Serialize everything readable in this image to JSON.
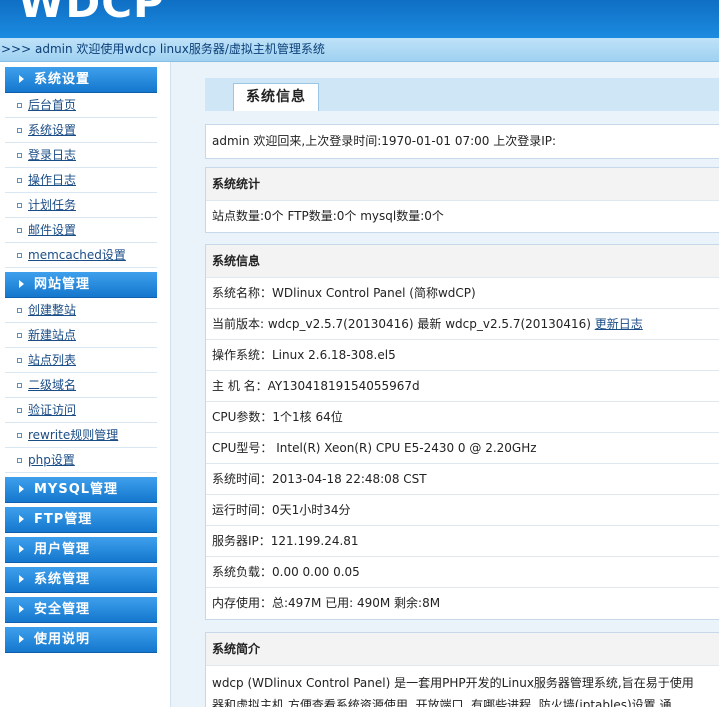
{
  "header": {
    "logo": "WDCP",
    "breadcrumb": ">>> admin 欢迎使用wdcp linux服务器/虚拟主机管理系统"
  },
  "sidebar": {
    "sections": [
      {
        "title": "系统设置",
        "items": [
          "后台首页",
          "系统设置",
          "登录日志",
          "操作日志",
          "计划任务",
          "邮件设置",
          "memcached设置"
        ]
      },
      {
        "title": "网站管理",
        "items": [
          "创建整站",
          "新建站点",
          "站点列表",
          "二级域名",
          "验证访问",
          "rewrite规则管理",
          "php设置"
        ]
      },
      {
        "title": "MYSQL管理",
        "items": []
      },
      {
        "title": "FTP管理",
        "items": []
      },
      {
        "title": "用户管理",
        "items": []
      },
      {
        "title": "系统管理",
        "items": []
      },
      {
        "title": "安全管理",
        "items": []
      },
      {
        "title": "使用说明",
        "items": []
      }
    ]
  },
  "main": {
    "tab": "系统信息",
    "welcome": "admin 欢迎回来,上次登录时间:1970-01-01 07:00 上次登录IP:",
    "stats": {
      "title": "系统统计",
      "line": "站点数量:0个  FTP数量:0个  mysql数量:0个"
    },
    "info": {
      "title": "系统信息",
      "name": "系统名称：WDlinux Control Panel (简称wdCP)",
      "version": "当前版本: wdcp_v2.5.7(20130416) 最新 wdcp_v2.5.7(20130416)",
      "changelog": "更新日志",
      "os": "操作系统：Linux 2.6.18-308.el5",
      "host": "主 机 名：AY13041819154055967d",
      "cpu_params": "CPU参数：1个1核 64位",
      "cpu_model": "CPU型号： Intel(R) Xeon(R) CPU E5-2430 0 @ 2.20GHz",
      "sys_time": "系统时间：2013-04-18 22:48:08 CST",
      "uptime": "运行时间：0天1小时34分",
      "ip": "服务器IP：121.199.24.81",
      "load": "系统负载：0.00   0.00   0.05",
      "memory": "内存使用：总:497M   已用: 490M   剩余:8M"
    },
    "intro": {
      "title": "系统简介",
      "line1": "wdcp (WDlinux Control Panel) 是一套用PHP开发的Linux服务器管理系统,旨在易于使用",
      "line2": "器和虚拟主机,方便查看系统资源使用, 开放端口, 有哪些进程, 防火墙(iptables)设置,通"
    }
  }
}
